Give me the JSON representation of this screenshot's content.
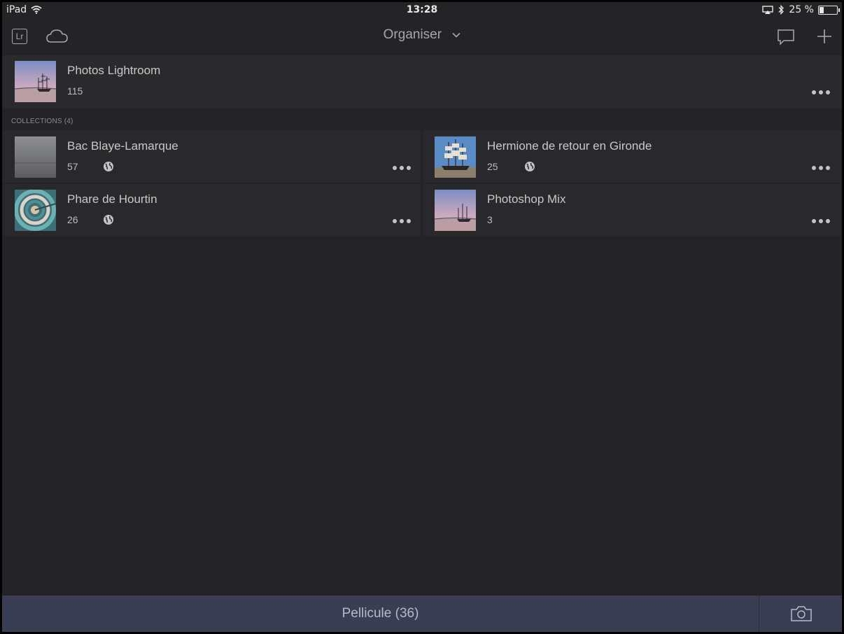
{
  "statusbar": {
    "device": "iPad",
    "time": "13:28",
    "battery": "25 %"
  },
  "navbar": {
    "title": "Organiser",
    "icons": [
      "lightroom-icon",
      "cloud-icon",
      "chevron-down-icon",
      "comment-icon",
      "plus-icon"
    ]
  },
  "library": {
    "title": "Photos Lightroom",
    "count": "115"
  },
  "collections_label": "COLLECTIONS (4)",
  "collections": [
    {
      "title": "Bac Blaye-Lamarque",
      "count": "57",
      "shared": true
    },
    {
      "title": "Hermione de retour en Gironde",
      "count": "25",
      "shared": true
    },
    {
      "title": "Phare de Hourtin",
      "count": "26",
      "shared": true
    },
    {
      "title": "Photoshop Mix",
      "count": "3",
      "shared": false
    }
  ],
  "bottombar": {
    "pellicule": "Pellicule (36)"
  },
  "colors": {
    "background": "#242426",
    "row": "#2a2a2c",
    "bottombar": "#3a3e52",
    "text": "#c9c9cb"
  }
}
